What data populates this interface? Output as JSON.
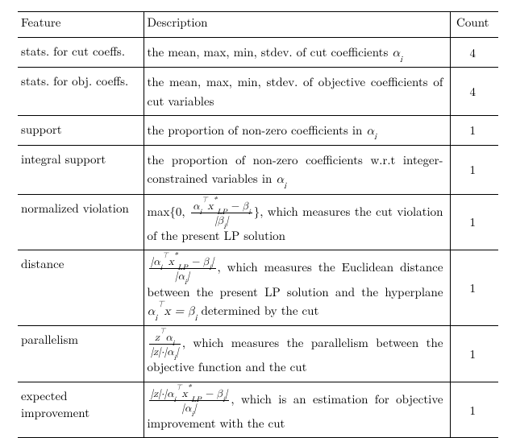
{
  "header": {
    "feature": "Feature",
    "description": "Description",
    "count": "Count"
  },
  "rows": [
    {
      "feature": "stats. for cut coeffs.",
      "desc_pre": "the mean, max, min, stdev. of cut coefficients ",
      "desc_post": "",
      "count": "4"
    },
    {
      "feature": "stats. for obj. coeffs.",
      "desc_pre": "the mean, max, min, stdev. of objective coefficients of cut variables",
      "desc_post": "",
      "count": "4"
    },
    {
      "feature": "support",
      "desc_pre": "the proportion of non-zero coefficients in ",
      "desc_post": "",
      "count": "1"
    },
    {
      "feature": "integral support",
      "desc_pre": "the proportion of non-zero coefficients w.r.t integer-constrained variables in ",
      "desc_post": "",
      "count": "1"
    },
    {
      "feature": "normalized violation",
      "desc_pre": "max{0, ",
      "desc_post": "}, which measures the cut violation of the present LP solution",
      "count": "1"
    },
    {
      "feature": "distance",
      "desc_pre": "",
      "desc_post": ", which measures the Euclidean distance between the present LP solution and the hyperplane ",
      "desc_tail": " determined by the cut",
      "count": "1"
    },
    {
      "feature": "parallelism",
      "desc_pre": "",
      "desc_post": ", which measures the parallelism between the objective function and the cut",
      "count": "1"
    },
    {
      "feature": "expected improvement",
      "desc_pre": "",
      "desc_post": ", which is an estimation for objective improvement with the cut",
      "count": "1"
    }
  ],
  "chart_data": {
    "type": "table",
    "columns": [
      "Feature",
      "Description",
      "Count"
    ],
    "rows": [
      [
        "stats. for cut coeffs.",
        "the mean, max, min, stdev. of cut coefficients α_i",
        4
      ],
      [
        "stats. for obj. coeffs.",
        "the mean, max, min, stdev. of objective coefficients of cut variables",
        4
      ],
      [
        "support",
        "the proportion of non-zero coefficients in α_i",
        1
      ],
      [
        "integral support",
        "the proportion of non-zero coefficients w.r.t integer-constrained variables in α_i",
        1
      ],
      [
        "normalized violation",
        "max{0, (α_iᵀ x*_LP − β_i) / |β_i| }, which measures the cut violation of the present LP solution",
        1
      ],
      [
        "distance",
        "|α_iᵀ x*_LP − β_i| / |α_i|, which measures the Euclidean distance between the present LP solution and the hyperplane α_iᵀ x = β_i determined by the cut",
        1
      ],
      [
        "parallelism",
        "zᵀ α_i / (|z|·|α_i|), which measures the parallelism between the objective function and the cut",
        1
      ],
      [
        "expected improvement",
        "|z|·|α_iᵀ x*_LP − β_i| / |α_i|, which is an estimation for objective improvement with the cut",
        1
      ]
    ]
  }
}
